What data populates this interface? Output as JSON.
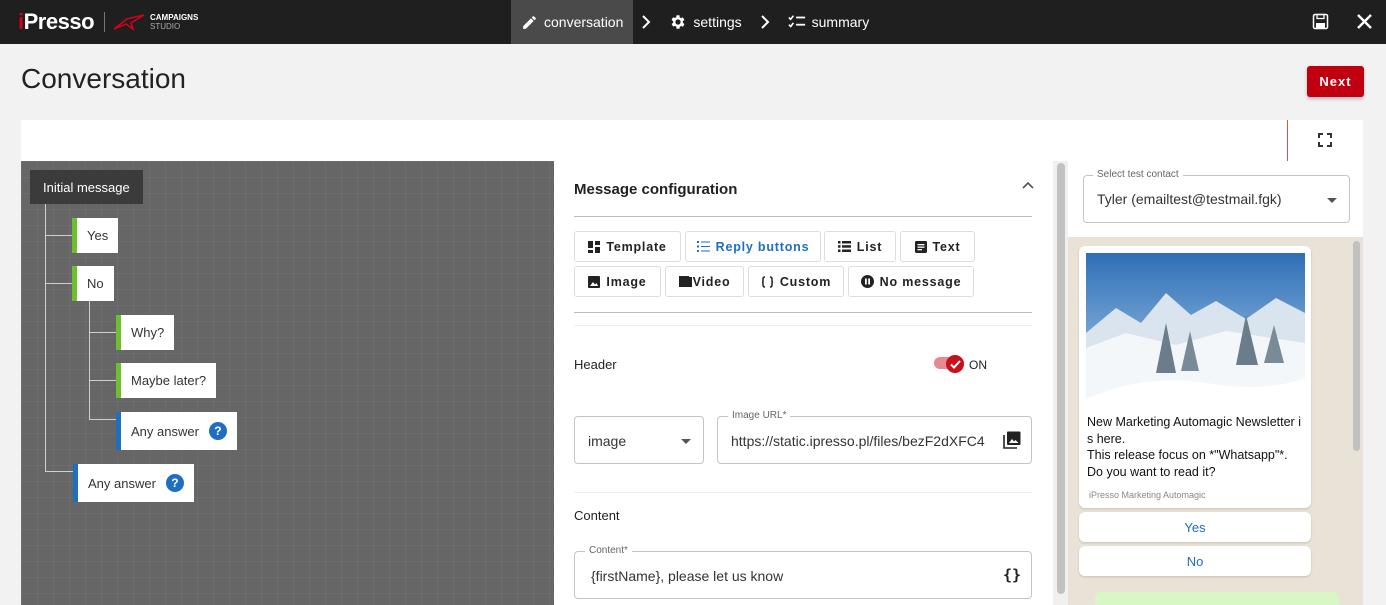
{
  "app": {
    "logo": "Presso",
    "logo_prefix": "i",
    "brand_line1": "CAMPAIGNS",
    "brand_line2": "STUDIO"
  },
  "steps": [
    {
      "label": "conversation",
      "icon": "pencil-icon",
      "active": true
    },
    {
      "label": "settings",
      "icon": "gear-icon",
      "active": false
    },
    {
      "label": "summary",
      "icon": "checklist-icon",
      "active": false
    }
  ],
  "page": {
    "title": "Conversation",
    "next_label": "Next"
  },
  "tree": {
    "root": "Initial message",
    "nodes": [
      "Yes",
      "No",
      "Why?",
      "Maybe later?",
      "Any answer",
      "Any answer"
    ]
  },
  "config": {
    "title": "Message configuration",
    "type_buttons": [
      {
        "label": "Template",
        "icon": "grid-icon",
        "selected": false
      },
      {
        "label": "Reply buttons",
        "icon": "list-icon",
        "selected": true
      },
      {
        "label": "List",
        "icon": "list-bullets-icon",
        "selected": false
      },
      {
        "label": "Text",
        "icon": "text-doc-icon",
        "selected": false
      },
      {
        "label": "Image",
        "icon": "image-icon",
        "selected": false
      },
      {
        "label": "Video",
        "icon": "video-icon",
        "selected": false
      },
      {
        "label": "Custom",
        "icon": "braces-icon",
        "selected": false
      },
      {
        "label": "No message",
        "icon": "pause-circle-icon",
        "selected": false
      }
    ],
    "header_label": "Header",
    "header_toggle": "ON",
    "header_type": "image",
    "image_url_label": "Image URL*",
    "image_url": "https://static.ipresso.pl/files/bezF2dXFC4",
    "content_label": "Content",
    "content_field_label": "Content*",
    "content_value": "{firstName}, please let us know"
  },
  "preview": {
    "contact_label": "Select test contact",
    "contact_value": "Tyler (emailtest@testmail.fgk)",
    "message_line1": "New Marketing Automagic Newsletter i",
    "message_line2": "s here.",
    "message_line3": "This release focus on *\"Whatsapp\"*.",
    "message_line4": "Do you want to read it?",
    "footer": "iPresso Marketing Automagic",
    "replies": [
      "Yes",
      "No"
    ]
  },
  "colors": {
    "accent_red": "#c00010",
    "reply_blue": "#1e6fc2",
    "branch_green": "#6cbf2f"
  }
}
